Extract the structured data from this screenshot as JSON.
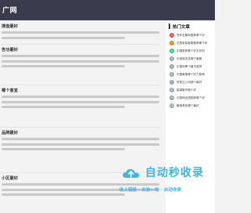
{
  "site": {
    "title": "广网"
  },
  "articles": [
    {
      "title": "搜盘最好",
      "meta": ""
    },
    {
      "title": "告功最好",
      "meta": ""
    },
    {
      "title": "哪个意宜",
      "meta": ""
    },
    {
      "title": "品牌最好",
      "meta": ""
    },
    {
      "title": "小区最好",
      "meta": ""
    }
  ],
  "sidebar": {
    "title": "热门文章",
    "items": [
      {
        "num": "1",
        "color": "#e74c3c",
        "label": "苍年全筹网推荐哪个好"
      },
      {
        "num": "2",
        "color": "#e67e22",
        "label": "艺居家装客服推荐哪个好"
      },
      {
        "num": "3",
        "color": "#2ecc71",
        "label": "中国推荐哪个好去年的"
      },
      {
        "num": "4",
        "color": "#95a5a6",
        "label": "长城商务选哪个最管"
      },
      {
        "num": "5",
        "color": "#95a5a6",
        "label": "中国网哪个最不推荐"
      },
      {
        "num": "6",
        "color": "#95a5a6",
        "label": "中国最管哪个好力推荐"
      },
      {
        "num": "7",
        "color": "#95a5a6",
        "label": "贸易达公司哪个最好"
      },
      {
        "num": "8",
        "color": "#95a5a6",
        "label": "高端集市哪个好"
      },
      {
        "num": "9",
        "color": "#95a5a6",
        "label": "中国网全国推荐哪个好"
      },
      {
        "num": "10",
        "color": "#95a5a6",
        "label": "最推荐的哪个最好"
      }
    ]
  },
  "watermark": {
    "brand": "自动秒收录",
    "tagline": "收上链接 · 未协一地 · 自动收录"
  }
}
